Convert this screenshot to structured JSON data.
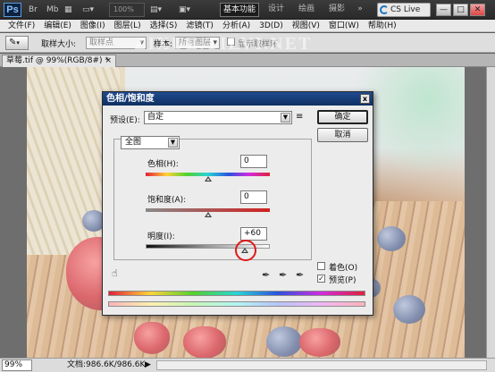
{
  "app": {
    "logo": "Ps",
    "zoom_placeholder": "100%",
    "workspaces": [
      "基本功能",
      "设计",
      "绘画",
      "摄影"
    ],
    "workspace_more": "»",
    "cs_live": "CS Live",
    "window_buttons": [
      "—",
      "□",
      "✕"
    ]
  },
  "menu": [
    "文件(F)",
    "编辑(E)",
    "图像(I)",
    "图层(L)",
    "选择(S)",
    "滤镜(T)",
    "分析(A)",
    "3D(D)",
    "视图(V)",
    "窗口(W)",
    "帮助(H)"
  ],
  "options_bar": {
    "sample_size_label": "取样大小:",
    "sample_size_value": "取样点",
    "sample_label": "样本:",
    "sample_value": "所有图层",
    "show_ring_label": "显示取样环"
  },
  "watermark": "ZIXUE.TILVI.NET",
  "document": {
    "tab_title": "草莓.tif @ 99%(RGB/8#) *",
    "tab_close": "×"
  },
  "status": {
    "zoom": "99%",
    "doc_info": "文档:986.6K/986.6K",
    "arrow": "▶"
  },
  "dialog": {
    "title": "色相/饱和度",
    "close": "x",
    "preset_label": "预设(E):",
    "preset_value": "自定",
    "preset_menu_icon": "≡",
    "ok": "确定",
    "cancel": "取消",
    "channel": "全图",
    "hue_label": "色相(H):",
    "hue_value": "0",
    "saturation_label": "饱和度(A):",
    "saturation_value": "0",
    "lightness_label": "明度(I):",
    "lightness_value": "+60",
    "colorize_label": "着色(O)",
    "colorize_checked": false,
    "preview_label": "预览(P)",
    "preview_checked": true,
    "lightness_level_fraction": 0.8
  }
}
